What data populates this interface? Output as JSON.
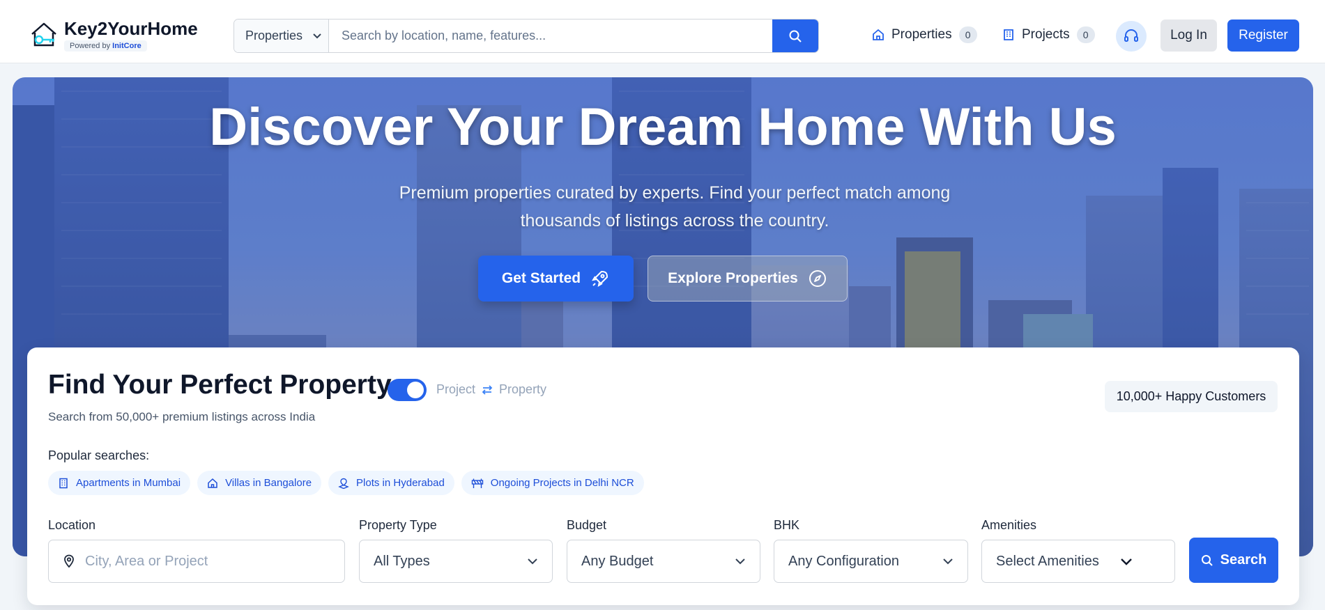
{
  "brand": {
    "name": "Key2YourHome",
    "powered_prefix": "Powered by",
    "powered_name": "InitCore"
  },
  "header": {
    "search_category": "Properties",
    "search_placeholder": "Search by location, name, features...",
    "nav": [
      {
        "label": "Properties",
        "count": "0",
        "icon": "home-icon"
      },
      {
        "label": "Projects",
        "count": "0",
        "icon": "building-icon"
      }
    ],
    "login_label": "Log In",
    "register_label": "Register"
  },
  "hero": {
    "title": "Discover Your Dream Home With Us",
    "subtitle": "Premium properties curated by experts. Find your perfect match among thousands of listings across the country.",
    "primary_cta": "Get Started",
    "secondary_cta": "Explore Properties"
  },
  "finder": {
    "title": "Find Your Perfect Property",
    "toggle_left": "Project",
    "toggle_right": "Property",
    "toggle_on": true,
    "subtitle": "Search from 50,000+ premium listings across India",
    "customers_badge": "10,000+ Happy Customers",
    "popular_label": "Popular searches:",
    "popular": [
      {
        "label": "Apartments in Mumbai",
        "icon": "apartment-icon"
      },
      {
        "label": "Villas in Bangalore",
        "icon": "villa-icon"
      },
      {
        "label": "Plots in Hyderabad",
        "icon": "plot-icon"
      },
      {
        "label": "Ongoing Projects in Delhi NCR",
        "icon": "construction-icon"
      }
    ],
    "fields": {
      "location": {
        "label": "Location",
        "placeholder": "City, Area or Project"
      },
      "property_type": {
        "label": "Property Type",
        "value": "All Types"
      },
      "budget": {
        "label": "Budget",
        "value": "Any Budget"
      },
      "bhk": {
        "label": "BHK",
        "value": "Any Configuration"
      },
      "amenities": {
        "label": "Amenities",
        "value": "Select Amenities"
      }
    },
    "search_label": "Search"
  },
  "colors": {
    "primary": "#2563eb",
    "chip_bg": "#eff6ff",
    "chip_text": "#1d4ed8"
  }
}
